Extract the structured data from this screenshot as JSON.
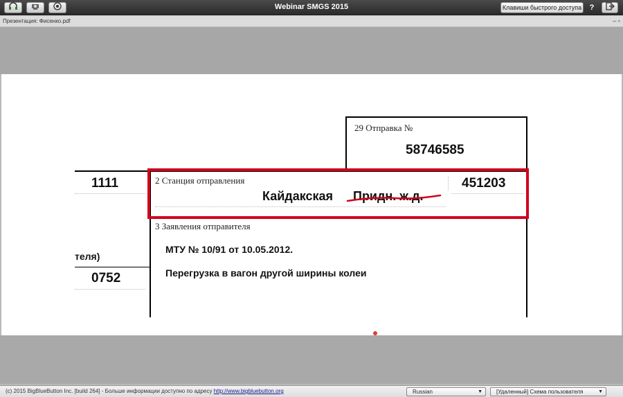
{
  "app": {
    "title": "Webinar SMGS 2015",
    "shortcuts_label": "Клавиши быстрого доступа",
    "help_label": "?"
  },
  "toolbar": {
    "icons": [
      "headset-icon",
      "webcam-icon",
      "record-icon",
      "logout-icon"
    ]
  },
  "presentation": {
    "title": "Презентация: Фисенко.pdf"
  },
  "slide": {
    "field29_label": "29 Отправка №",
    "field29_value": "58746585",
    "left_top_value": "1111",
    "field2_label": "2 Станция отправления",
    "field2_station": "Кайдакская",
    "field2_struck": "Придн. ж.д.",
    "field2_code": "451203",
    "field3_label": "3 Заявления отправителя",
    "field3_line1": "МТУ № 10/91 от 10.05.2012.",
    "field3_line2": "Перегрузка в вагон другой ширины колеи",
    "left_partial_label": "теля)",
    "left_bottom_value": "0752",
    "highlight_color": "#d0021b",
    "strike_color": "#d0021b"
  },
  "statusbar": {
    "copyright": "(c) 2015 BigBlueButton Inc. [build 264] - Больше информации доступно по адресу",
    "link": "http://www.bigbluebutton.org",
    "language": "Russian",
    "layout": "[Удаленный] Схема пользователя"
  }
}
